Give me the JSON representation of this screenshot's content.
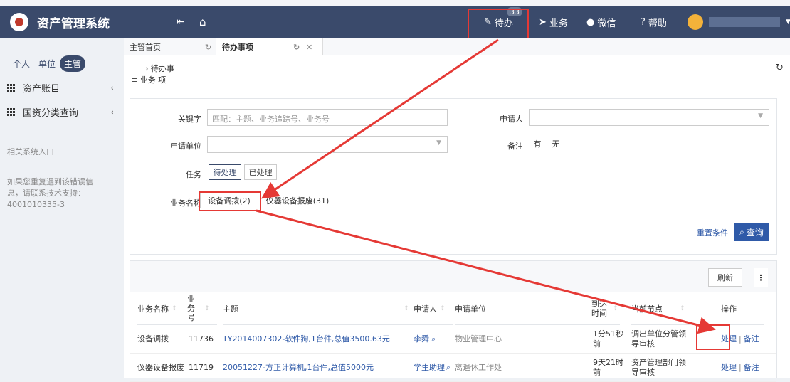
{
  "app": {
    "title": "资产管理系统"
  },
  "topnav": {
    "todo_label": "待办",
    "todo_count": "33",
    "business_label": "业务",
    "wechat_label": "微信",
    "help_label": "帮助"
  },
  "sidebar": {
    "segments": [
      "个人",
      "单位",
      "主管"
    ],
    "items": [
      {
        "label": "资产账目"
      },
      {
        "label": "国资分类查询"
      }
    ],
    "related_entry": "相关系统入口",
    "support_text": "如果您重复遇到该错误信息，请联系技术支持：",
    "support_phone": "4001010335-3"
  },
  "tabs": [
    {
      "label": "主管首页"
    },
    {
      "label": "待办事项"
    }
  ],
  "breadcrumb": {
    "line1": "› 待办事",
    "line2": "≡ 业务 项"
  },
  "filter": {
    "keyword_label": "关键字",
    "keyword_placeholder": "匹配：主题、业务追踪号、业务号",
    "applicant_label": "申请人",
    "unit_label": "申请单位",
    "remark_label": "备注",
    "remark_yes": "有",
    "remark_no": "无",
    "task_label": "任务",
    "task_pending": "待处理",
    "task_done": "已处理",
    "bizname_label": "业务名称",
    "biz_options": [
      "设备调拨(2)",
      "仪器设备报废(31)"
    ],
    "reset_label": "重置条件",
    "query_label": "查询"
  },
  "table": {
    "refresh_label": "刷新",
    "columns": [
      "业务名称",
      "业务号",
      "主题",
      "申请人",
      "申请单位",
      "到达时间",
      "当前节点",
      "操作"
    ],
    "rows": [
      {
        "bizname": "设备调拨",
        "bizno": "11736",
        "subject": "TY2014007302-软件狗,1台件,总值3500.63元",
        "applicant": "李舜",
        "unit": "物业管理中心",
        "arrival": "1分51秒前",
        "node": "调出单位分管领导审核",
        "action_process": "处理",
        "action_remark": "备注"
      },
      {
        "bizname": "仪器设备报废",
        "bizno": "11719",
        "subject": "20051227-方正计算机,1台件,总值5000元",
        "applicant": "学生助理",
        "unit": "离退休工作处",
        "arrival": "9天21时前",
        "node": "资产管理部门领导审核",
        "action_process": "处理",
        "action_remark": "备注"
      }
    ]
  },
  "colors": {
    "topbar": "#3a4a6b",
    "highlight": "#e53935",
    "link": "#2f5aa8"
  }
}
